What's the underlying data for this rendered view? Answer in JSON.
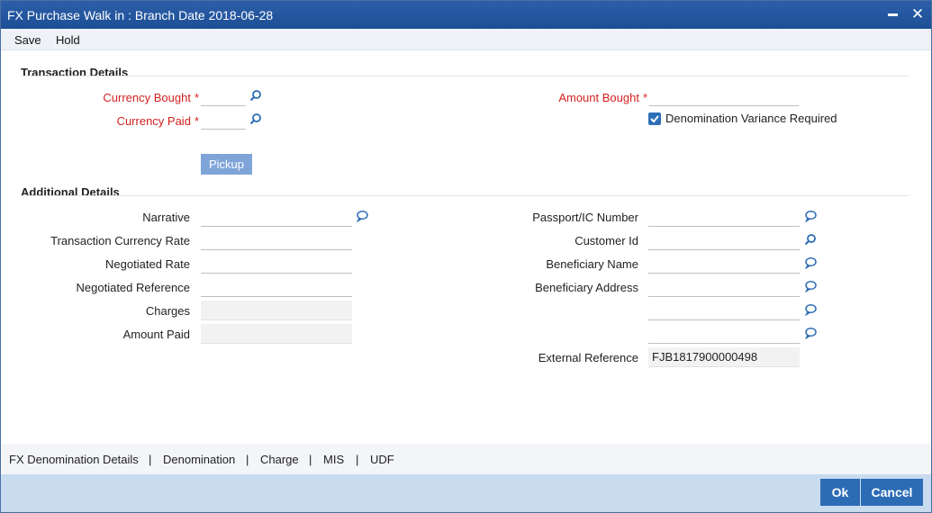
{
  "window": {
    "title": "FX Purchase Walk in : Branch Date 2018-06-28"
  },
  "menu": {
    "save_label": "Save",
    "hold_label": "Hold"
  },
  "transaction_details": {
    "heading": "Transaction Details",
    "currency_bought_label": "Currency Bought",
    "currency_bought_value": "",
    "currency_paid_label": "Currency Paid",
    "currency_paid_value": "",
    "amount_bought_label": "Amount Bought",
    "amount_bought_value": "",
    "required_marker": "*",
    "denomination_variance_label": "Denomination Variance Required",
    "denomination_variance_checked": true,
    "pickup_label": "Pickup"
  },
  "additional_details": {
    "heading": "Additional Details",
    "narrative_label": "Narrative",
    "narrative_value": "",
    "transaction_currency_rate_label": "Transaction Currency Rate",
    "transaction_currency_rate_value": "",
    "negotiated_rate_label": "Negotiated Rate",
    "negotiated_rate_value": "",
    "negotiated_reference_label": "Negotiated Reference",
    "negotiated_reference_value": "",
    "charges_label": "Charges",
    "charges_value": "",
    "amount_paid_label": "Amount Paid",
    "amount_paid_value": "",
    "passport_label": "Passport/IC Number",
    "passport_value": "",
    "customer_id_label": "Customer Id",
    "customer_id_value": "",
    "beneficiary_name_label": "Beneficiary Name",
    "beneficiary_name_value": "",
    "beneficiary_address_label": "Beneficiary Address",
    "beneficiary_address_line1": "",
    "beneficiary_address_line2": "",
    "beneficiary_address_line3": "",
    "external_reference_label": "External Reference",
    "external_reference_value": "FJB1817900000498"
  },
  "tabs": [
    {
      "label": "FX Denomination Details"
    },
    {
      "label": "Denomination"
    },
    {
      "label": "Charge"
    },
    {
      "label": "MIS"
    },
    {
      "label": "UDF"
    }
  ],
  "tab_separator": "|",
  "footer": {
    "ok_label": "Ok",
    "cancel_label": "Cancel"
  },
  "colors": {
    "title_bar": "#1d4f96",
    "required_label": "#d42020",
    "primary_button": "#2c6cb5",
    "pickup_button": "#7fa4d8",
    "footer_bg": "#c9dbef"
  },
  "icons": {
    "lov": "search-icon",
    "narrative_edit": "speech-bubble-icon",
    "minimize": "minimize-icon",
    "close": "close-icon",
    "checkbox": "checkmark-icon"
  }
}
